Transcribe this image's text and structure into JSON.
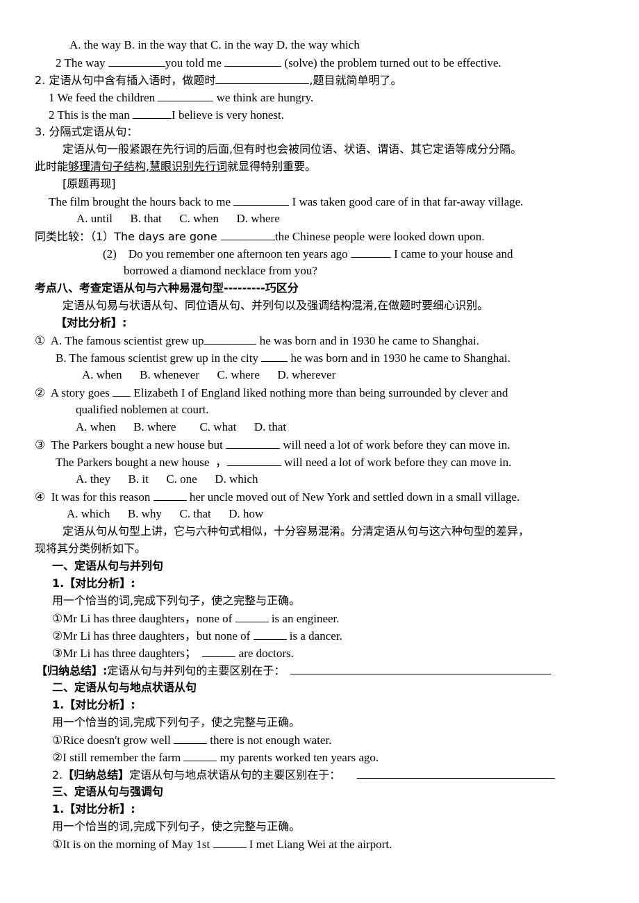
{
  "lines": {
    "l01": "A. the way B. in the way that C. in the way D. the way which",
    "l02a": "2 The way ",
    "l02b": "you told me ",
    "l02c": " (solve) the problem turned out to be effective.",
    "l03a": "2. 定语从句中含有插入语时，做题时",
    "l03b": ",题目就简单明了。",
    "l04a": "1 We feed the children ",
    "l04b": " we think are hungry.",
    "l05a": "2 This is the man ",
    "l05b": "I believe is very honest.",
    "l06": "3. 分隔式定语从句：",
    "l07": "定语从句一般紧跟在先行词的后面,但有时也会被同位语、状语、谓语、其它定语等成分分隔。",
    "l08a": "此时能",
    "l08b": "够理清句子结构,慧眼识别先行词",
    "l08c": "就显得特别重要。",
    "l09": "[原题再现]",
    "l10a": "The film brought the hours back to me ",
    "l10b": " I was taken good care of in that far-away village.",
    "l11": "A. until      B. that      C. when      D. where",
    "l12a": "同类比较：（1）The days are gone ",
    "l12b": "the Chinese people were looked down upon.",
    "l13a": "(2)    Do you remember one afternoon ten years ago ",
    "l13b": " I came to your house and",
    "l14": "borrowed a diamond necklace from you?",
    "l15": "考点八、考查定语从句与六种易混句型---------巧区分",
    "l16": "定语从句易与状语从句、同位语从句、并列句以及强调结构混淆,在做题时要细心识别。",
    "l17": "【对比分析】:",
    "l18a": "①  A. The famous scientist grew up",
    "l18b": " he was born and in 1930 he came to Shanghai.",
    "l19a": "B. The famous scientist grew up in the city ",
    "l19b": " he was born and in 1930 he came to Shanghai.",
    "l20": "A. when      B. whenever      C. where      D. wherever",
    "l21a": "②  A story goes ",
    "l21b": " Elizabeth I of England liked nothing more than being surrounded by clever and",
    "l22": "qualified noblemen at court.",
    "l23": "A. when      B. where        C. what      D. that",
    "l24a": "③  The Parkers bought a new house but ",
    "l24b": " will need a lot of work before they can move in.",
    "l25a": "The Parkers bought a new house  ，",
    "l25b": " will need a lot of work before they can move in.",
    "l26": "A. they      B. it      C. one      D. which",
    "l27a": "④  It was for this reason ",
    "l27b": " her uncle moved out of New York and settled down in a small village.",
    "l28": "A. which      B. why      C. that      D. how",
    "l29": "定语从句从句型上讲，它与六种句式相似，十分容易混淆。分清定语从句与这六种句型的差异，",
    "l30": "现将其分类例析如下。",
    "l31": "一、定语从句与并列句",
    "l32": "1.【对比分析】:",
    "l33": "用一个恰当的词,完成下列句子，使之完整与正确。",
    "l34a": "①Mr Li has three daughters，none of ",
    "l34b": " is an engineer.",
    "l35a": "②Mr Li has three daughters，but none of ",
    "l35b": " is a dancer.",
    "l36a": "③Mr Li has three daughters；  ",
    "l36b": " are doctors.",
    "l37a": "【归纳总结】:",
    "l37b": "定语从句与并列句的主要区别在于：",
    "l38": "二、定语从句与地点状语从句",
    "l39": "1.【对比分析】:",
    "l40": "用一个恰当的词,完成下列句子，使之完整与正确。",
    "l41a": "①Rice doesn't grow well ",
    "l41b": " there is not enough water.",
    "l42a": "②I still remember the farm ",
    "l42b": " my parents worked ten years ago.",
    "l43a": "2.",
    "l43b": "【归纳总结】",
    "l43c": "定语从句与地点状语从句的主要区别在于：",
    "l44": "三、定语从句与强调句",
    "l45": "1.【对比分析】:",
    "l46": "用一个恰当的词,完成下列句子，使之完整与正确。",
    "l47a": "①It is on the morning of May 1st ",
    "l47b": " I met Liang Wei at the airport."
  }
}
